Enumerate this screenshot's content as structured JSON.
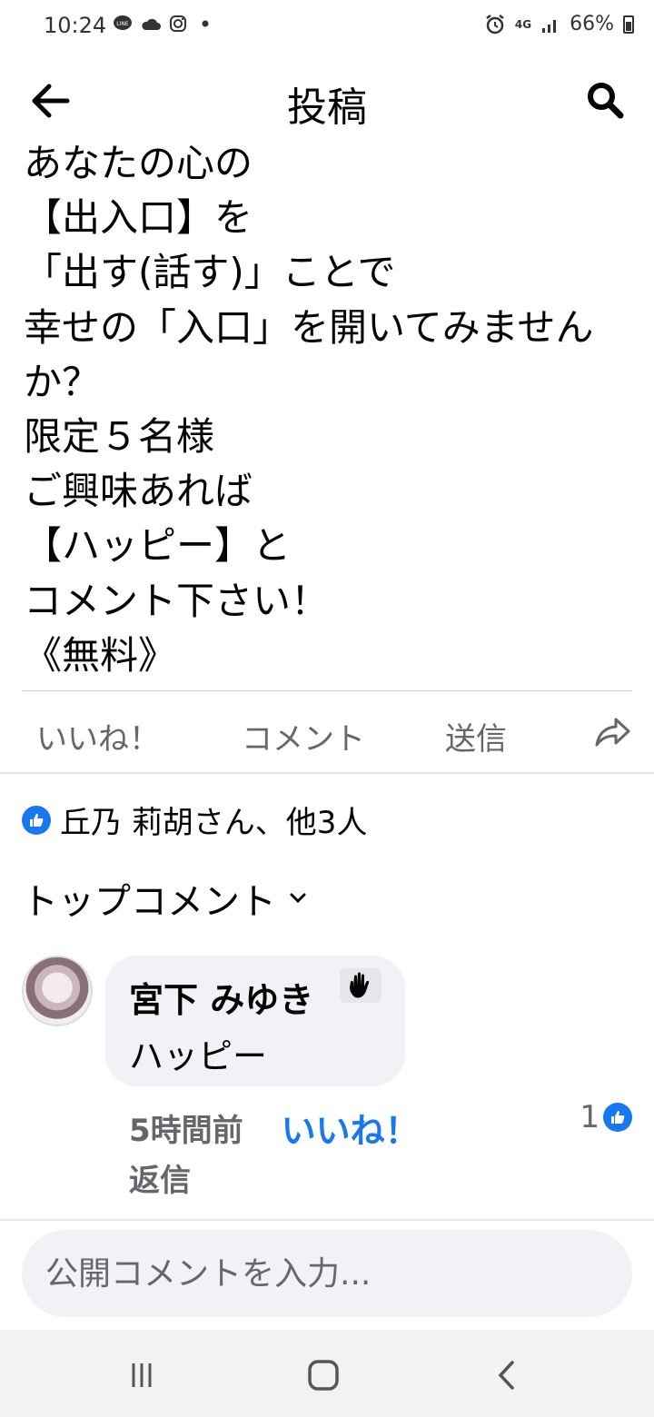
{
  "status_bar": {
    "time": "10:24",
    "icons_left": [
      "line-icon",
      "cloud-icon",
      "instagram-icon",
      "dot-icon"
    ],
    "network": "4G",
    "battery": "66%"
  },
  "header": {
    "title": "投稿"
  },
  "post": {
    "text": "あなたの心の\n【出入口】を\n「出す(話す)」ことで\n幸せの「入口」を開いてみませんか？\n限定５名様\nご興味あれば\n【ハッピー】と\nコメント下さい！\n《無料》"
  },
  "actions": {
    "like": "いいね！",
    "comment": "コメント",
    "send": "送信"
  },
  "reactions": {
    "text": "丘乃 莉胡さん、他3人"
  },
  "comments_sort": {
    "label": "トップコメント"
  },
  "comment": {
    "author": "宮下 みゆき",
    "text": "ハッピー",
    "time": "5時間前",
    "like_label": "いいね！",
    "reply_label": "返信",
    "like_count": "1"
  },
  "comment_input": {
    "placeholder": "公開コメントを入力..."
  },
  "colors": {
    "accent": "#1877f2",
    "secondary_text": "#65676b",
    "bubble": "#f0f2f5"
  }
}
